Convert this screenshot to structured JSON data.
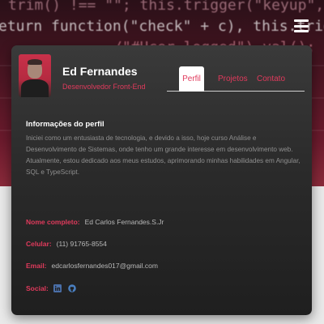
{
  "hero": {
    "code_lines": [
      "trim() !== \"\"; this.trigger(\"keyup\",",
      "eturn function(\"check\" + c), this.trigger(",
      "/\"#Ucer_logged\").val();"
    ]
  },
  "profile": {
    "name": "Ed Fernandes",
    "role": "Desenvolvedor Front-End"
  },
  "tabs": [
    {
      "label": "Perfil",
      "active": true
    },
    {
      "label": "Projetos",
      "active": false
    },
    {
      "label": "Contato",
      "active": false
    }
  ],
  "about": {
    "title": "Informações do perfil",
    "text": "Iniciei como um entusiasta de tecnologia, e devido a isso, hoje curso Análise e Desenvolvimento de Sistemas, onde tenho um grande interesse em desenvolvimento web. Atualmente, estou dedicado aos meus estudos, aprimorando minhas habilidades em Angular, SQL e TypeScript."
  },
  "details": {
    "nome_label": "Nome completo:",
    "nome_value": "Ed Carlos Fernandes.S.Jr",
    "celular_label": "Celular:",
    "celular_value": "(11) 91765-8554",
    "email_label": "Email:",
    "email_value": "edcarlosfernandes017@gmail.com",
    "social_label": "Social:",
    "social_icons": [
      "linkedin-icon",
      "github-icon"
    ]
  },
  "colors": {
    "accent": "#e03a5c",
    "card_bg": "#2b2b2b",
    "page_bg": "#e9e9e9"
  }
}
